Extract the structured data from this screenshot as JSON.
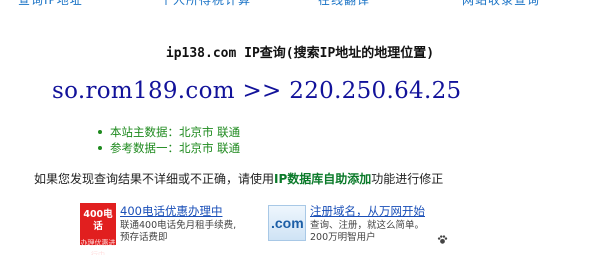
{
  "top_links": [
    "查询IP地址",
    "个人所得税计算",
    "在线翻译",
    "网站收录查询"
  ],
  "title": "ip138.com IP查询(搜索IP地址的地理位置)",
  "query": {
    "domain": "so.rom189.com",
    "separator": ">>",
    "ip": "220.250.64.25"
  },
  "results": [
    {
      "label": "本站主数据：",
      "value": "北京市 联通"
    },
    {
      "label": "参考数据一：",
      "value": "北京市 联通"
    }
  ],
  "notice": {
    "prefix": "如果您发现查询结果不详细或不正确，请使用",
    "link": "IP数据库自助添加",
    "suffix": "功能进行修正"
  },
  "ads": {
    "left": {
      "logo_line1": "400电话",
      "logo_line2": "办理优惠进行中",
      "title": "400电话优惠办理中",
      "desc": "联通400电话免月租手续费, 预存话费即"
    },
    "right": {
      "logo_text": ".com",
      "title": "注册域名，从万网开始",
      "desc": "查询、注册，就这么简单。200万明智用户"
    }
  },
  "colors": {
    "query": "#12129a",
    "results": "#1e8a1e",
    "notice_link": "#0b7a2a",
    "ad_title": "#1a4fb8"
  }
}
